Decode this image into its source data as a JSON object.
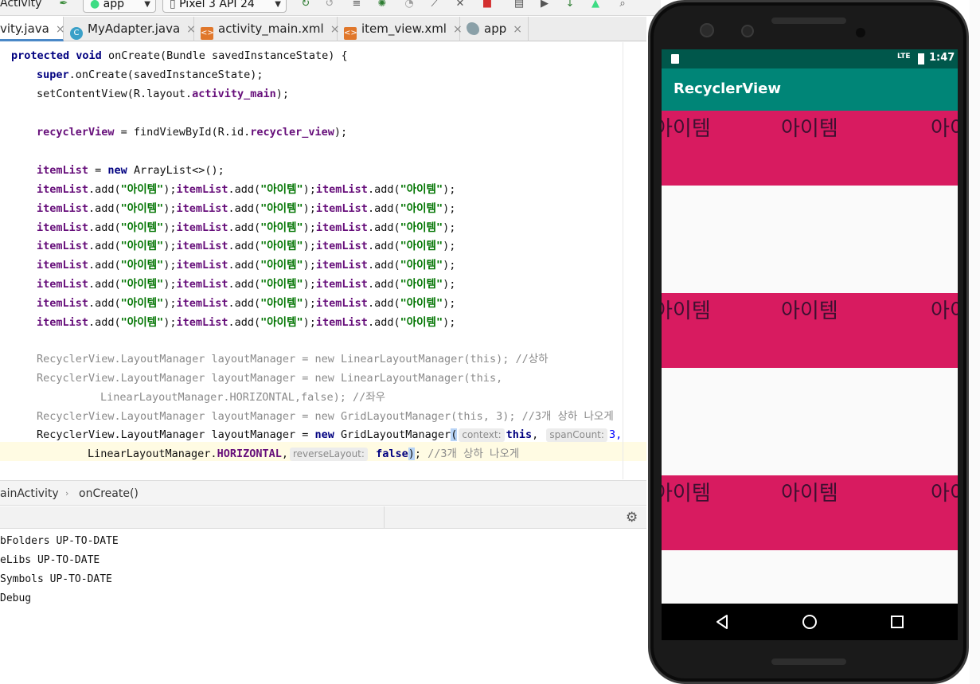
{
  "toolbar": {
    "config_partial": "Activity",
    "module_combo": "app",
    "device_combo": "Pixel 3 API 24"
  },
  "tabs": [
    {
      "label": "vity.java",
      "icon": "java-class-icon"
    },
    {
      "label": "MyAdapter.java",
      "icon": "class-c-icon"
    },
    {
      "label": "activity_main.xml",
      "icon": "xml-layout-icon"
    },
    {
      "label": "item_view.xml",
      "icon": "xml-layout-icon"
    },
    {
      "label": "app",
      "icon": "android-module-icon"
    }
  ],
  "code": {
    "l1_a": "protected",
    "l1_b": "void",
    "l1_c": " onCreate(Bundle savedInstanceState) {",
    "l2_a": "super",
    "l2_b": ".onCreate(savedInstanceState);",
    "l3_a": "setContentView(R.layout.",
    "l3_b": "activity_main",
    "l3_c": ");",
    "l4_a": "recyclerView",
    "l4_b": " = findViewById(R.id.",
    "l4_c": "recycler_view",
    "l4_d": ");",
    "l5_a": "itemList",
    "l5_b": " = ",
    "l5_c": "new",
    "l5_d": " ArrayList<>();",
    "item_list": "itemList",
    "add_call": ".add(",
    "item_str": "\"아이템\"",
    "close_stmt": ");",
    "lm_type": "RecyclerView.LayoutManager layoutManager = new LinearLayoutManager(this); ",
    "lm_cmt1": "//상하",
    "lm2_a": "RecyclerView.LayoutManager layoutManager = new LinearLayoutManager(this,",
    "lm2_b": "LinearLayoutManager.HORIZONTAL,false); ",
    "lm2_cmt": "//좌우",
    "lm3_a": "RecyclerView.LayoutManager layoutManager = new GridLayoutManager(this, 3); ",
    "lm3_cmt": "//3개 상하 나오게",
    "lm4_a": "RecyclerView.LayoutManager layoutManager = ",
    "lm4_new": "new",
    "lm4_b": " GridLayoutManager",
    "lm4_paren": "(",
    "hint_context": "context:",
    "lm4_this": "this",
    "lm4_comma": ",",
    "hint_span": "spanCount:",
    "lm4_three": "3,",
    "lm5_a": "LinearLayoutManager.",
    "lm5_b": "HORIZONTAL",
    "lm5_c": ",",
    "hint_reverse": "reverseLayout:",
    "lm5_false": "false",
    "lm5_close_paren": ")",
    "lm5_semi": "; ",
    "lm5_cmt": "//3개 상하 나오게"
  },
  "breadcrumb": {
    "class": "ainActivity",
    "method": "onCreate()"
  },
  "console": [
    "bFolders UP-TO-DATE",
    "eLibs UP-TO-DATE",
    "Symbols UP-TO-DATE",
    "Debug"
  ],
  "emulator": {
    "clock": "1:47",
    "network": "LTE",
    "app_title": "RecyclerView",
    "item_label": "아이템"
  },
  "colors": {
    "app_bar": "#008577",
    "status_bar": "#00574b",
    "item_bg": "#d81b60"
  }
}
